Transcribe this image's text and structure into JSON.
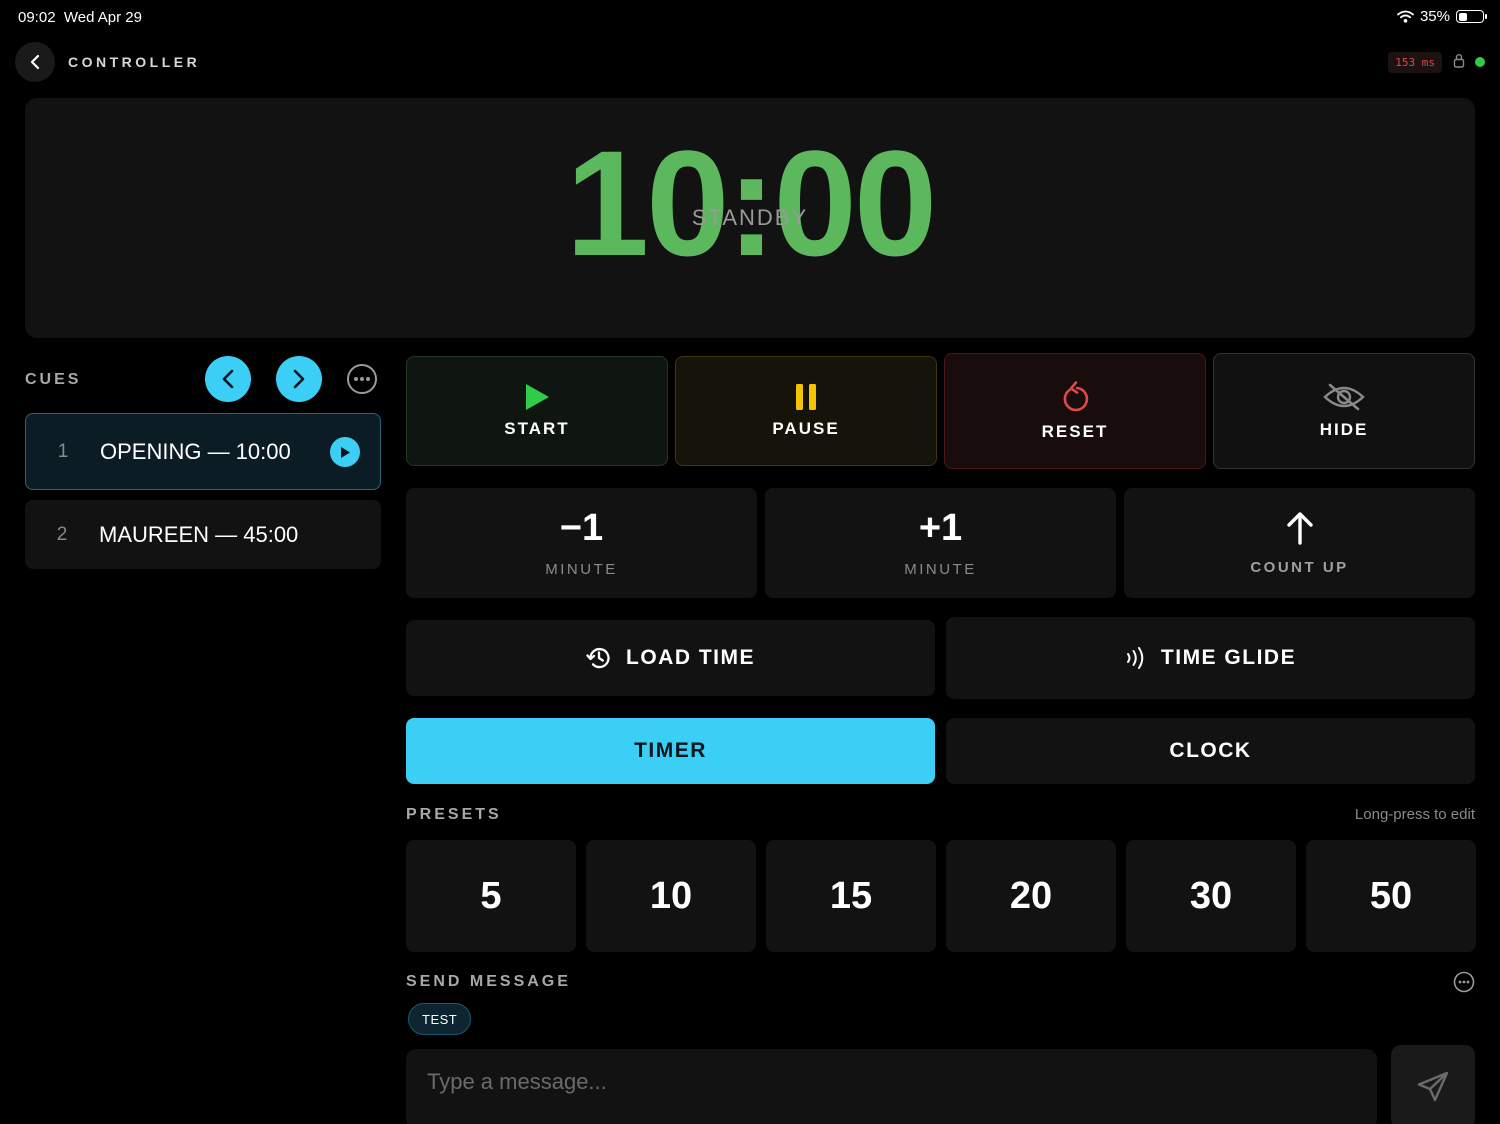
{
  "status_bar": {
    "time": "09:02",
    "date": "Wed Apr 29",
    "battery": "35%",
    "battery_level": 0.35
  },
  "header": {
    "title": "CONTROLLER",
    "latency": "153 ms",
    "connected": true
  },
  "display": {
    "time": "10:00",
    "state": "STANDBY",
    "time_color": "#5cb85c"
  },
  "cues": {
    "label": "CUES",
    "items": [
      {
        "number": "1",
        "name": "OPENING — 10:00",
        "active": true
      },
      {
        "number": "2",
        "name": "MAUREEN — 45:00",
        "active": false
      }
    ]
  },
  "transport": {
    "start": "START",
    "pause": "PAUSE",
    "reset": "RESET",
    "hide": "HIDE"
  },
  "adjust": {
    "minus": {
      "value": "−1",
      "label": "MINUTE"
    },
    "plus": {
      "value": "+1",
      "label": "MINUTE"
    },
    "count_up": {
      "label": "COUNT UP"
    }
  },
  "actions": {
    "load_time": "LOAD TIME",
    "time_glide": "TIME GLIDE"
  },
  "modes": {
    "timer": "TIMER",
    "clock": "CLOCK",
    "selected": "TIMER"
  },
  "presets": {
    "label": "PRESETS",
    "hint": "Long-press to edit",
    "values": [
      "5",
      "10",
      "15",
      "20",
      "30",
      "50"
    ]
  },
  "message": {
    "label": "SEND MESSAGE",
    "chip": "TEST",
    "placeholder": "Type a message..."
  },
  "colors": {
    "accent": "#3bcff5",
    "start": "#2ecc48",
    "pause": "#f5c400",
    "reset": "#e34848",
    "connected": "#2ecc48",
    "latency": "#e04848"
  }
}
